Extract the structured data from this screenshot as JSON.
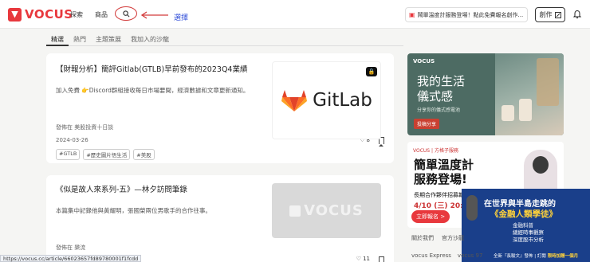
{
  "header": {
    "logo_text": "VOCUS",
    "nav": {
      "explore": "探索",
      "products": "商品"
    },
    "annotation_label": "選擇",
    "promo": "鬧單溫度計服務登場！點此免費報名創作...",
    "create_label": "創作"
  },
  "tabs": [
    {
      "label": "精選"
    },
    {
      "label": "熱門"
    },
    {
      "label": "主題策展"
    },
    {
      "label": "我加入的沙龍"
    }
  ],
  "articles": [
    {
      "title": "【財報分析】簡評Gitlab(GTLB)早前發布的2023Q4業績",
      "desc": "加入免費 👉Discord群組接收每日市場要聞，經濟數據和文章更新通知。",
      "meta": "發佈在 美股投資十日談",
      "date": "2024-03-26",
      "tags": [
        "#GTLB",
        "#歷史圖片悟生活",
        "#美股"
      ],
      "likes": "8",
      "thumb_text": "GitLab"
    },
    {
      "title": "《似是故人來系列-五》—林夕訪問筆錄",
      "desc": "本篇集中記錄他與黃耀明，張國榮兩位男歌手的合作往事。",
      "meta": "發佈在 樂流",
      "likes": "11",
      "thumb_text": "VOCUS"
    }
  ],
  "sidebar": {
    "ad1": {
      "brand": "VOCUS",
      "title_line1": "我的生活",
      "title_line2": "儀式感",
      "sub": "分享你的儀式感電池",
      "button": "投稿分享"
    },
    "ad2": {
      "brand": "VOCUS | 方格子服務",
      "title_line1": "簡單溫度計",
      "title_line2": "服務登場!",
      "line1": "長期合作夥伴招募報名",
      "line2": "4/10 (三) 20:00-2",
      "signup": "立即報名 >"
    },
    "ad3": {
      "line1": "在世界與半島走跳的",
      "line2": "《金融人類學徒》",
      "list": [
        "金融科普",
        "總經時事觀察",
        "深度股市分析"
      ],
      "footer_a": "全新『長駿文』發佈 | 訂閱",
      "footer_b": "限時加贈一個月"
    },
    "about": [
      "關於我們",
      "官方沙龍"
    ],
    "about2": [
      "vocus Express",
      "vocus 97"
    ]
  },
  "status_url": "https://vocus.cc/article/66023657fd89780001f1fcdd"
}
